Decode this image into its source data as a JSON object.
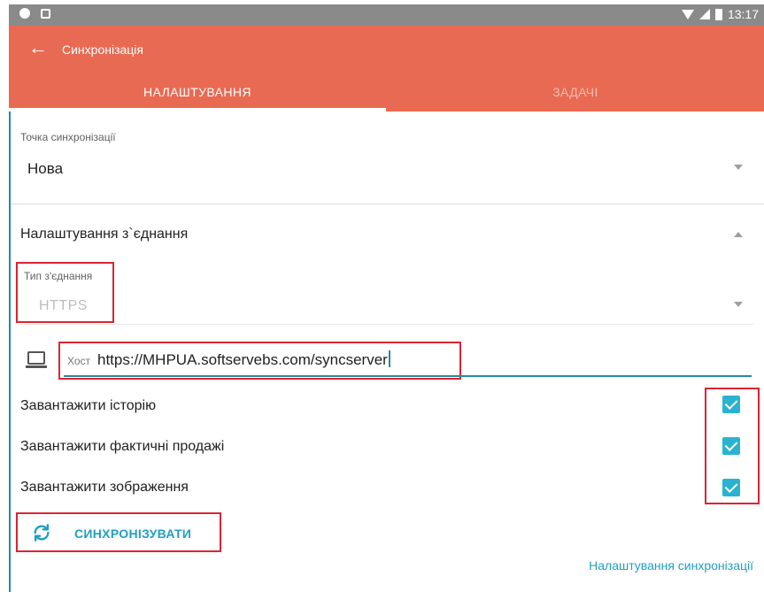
{
  "status_bar": {
    "time": "13:17"
  },
  "app_bar": {
    "back_icon": "arrow-left-icon",
    "title": "Синхронізація"
  },
  "tabs": [
    {
      "label": "НАЛАШТУВАННЯ",
      "active": true
    },
    {
      "label": "ЗАДАЧІ",
      "active": false
    }
  ],
  "sync_point": {
    "label": "Точка синхронізації",
    "value": "Нова"
  },
  "connection": {
    "title": "Налаштування з`єднання",
    "type_label": "Тип з'єднання",
    "type_value": "HTTPS",
    "host_label": "Хост",
    "host_value": "https://MHPUA.softservebs.com/syncserver"
  },
  "checkboxes": [
    {
      "label": "Завантажити історію",
      "checked": true
    },
    {
      "label": "Завантажити фактичні продажі",
      "checked": true
    },
    {
      "label": "Завантажити зображення",
      "checked": true
    }
  ],
  "sync_button": {
    "label": "СИНХРОНІЗУВАТИ",
    "icon": "sync-icon"
  },
  "settings_link": "Налаштування синхронізації",
  "colors": {
    "accent": "#e96a52",
    "teal": "#1f8ea0",
    "checkbox": "#2ab3d1",
    "highlight": "#dc2434"
  }
}
